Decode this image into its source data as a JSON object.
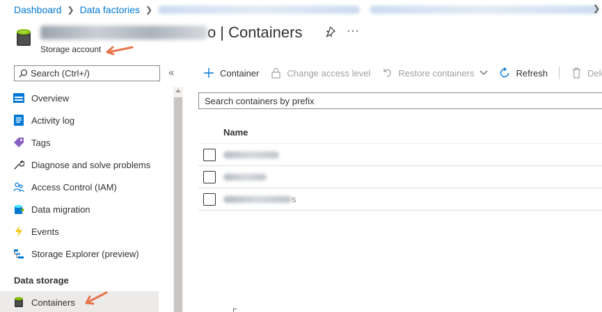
{
  "breadcrumb": {
    "items": [
      "Dashboard",
      "Data factories"
    ]
  },
  "header": {
    "title_tail": "o",
    "title": "| Containers",
    "subtitle": "Storage account",
    "more": "···"
  },
  "sidebar": {
    "search_placeholder": "Search (Ctrl+/)",
    "collapse": "«",
    "items": [
      {
        "label": "Overview",
        "icon": "overview-icon"
      },
      {
        "label": "Activity log",
        "icon": "activity-log-icon"
      },
      {
        "label": "Tags",
        "icon": "tag-icon"
      },
      {
        "label": "Diagnose and solve problems",
        "icon": "wrench-icon"
      },
      {
        "label": "Access Control (IAM)",
        "icon": "people-icon"
      },
      {
        "label": "Data migration",
        "icon": "data-migration-icon"
      },
      {
        "label": "Events",
        "icon": "lightning-icon"
      },
      {
        "label": "Storage Explorer (preview)",
        "icon": "storage-explorer-icon"
      }
    ],
    "section_label": "Data storage",
    "selected_item": {
      "label": "Containers",
      "icon": "container-icon"
    }
  },
  "toolbar": {
    "container": "Container",
    "change_access": "Change access level",
    "restore": "Restore containers",
    "refresh": "Refresh",
    "delete": "Delete"
  },
  "main": {
    "search_placeholder": "Search containers by prefix",
    "column_name": "Name",
    "rows": [
      {
        "tail": ""
      },
      {
        "tail": ""
      },
      {
        "tail": "s"
      }
    ]
  },
  "colors": {
    "link": "#0078d4",
    "accent": "#0078d4",
    "annotation": "#e8744a"
  }
}
